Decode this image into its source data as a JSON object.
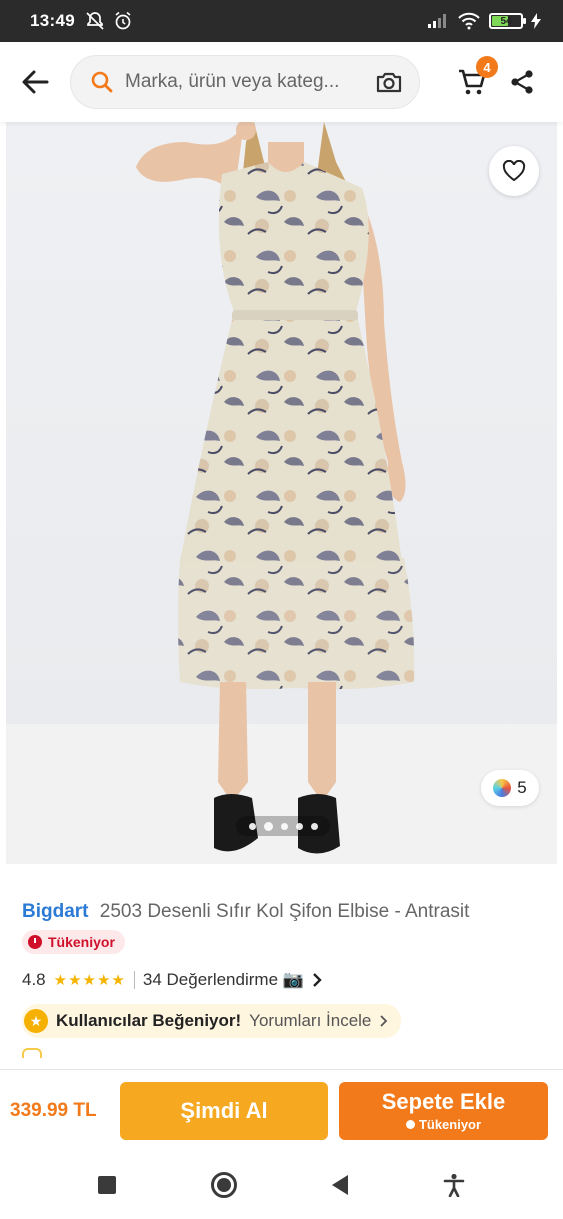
{
  "status_bar": {
    "time": "13:49",
    "battery_level": "54"
  },
  "header": {
    "search_placeholder": "Marka, ürün veya kateg...",
    "cart_count": "4"
  },
  "product_image": {
    "color_count": "5",
    "carousel_pages": 5,
    "active_page": 2
  },
  "product": {
    "brand": "Bigdart",
    "name": "2503 Desenli Sıfır Kol Şifon Elbise - Antrasit",
    "stock_status": "Tükeniyor",
    "rating": "4.8",
    "stars": "★★★★★",
    "review_count": "34 Değerlendirme 📷",
    "liked_label": "Kullanıcılar Beğeniyor!",
    "reviews_link": "Yorumları İncele"
  },
  "bottom_bar": {
    "price": "339.99 TL",
    "buy_now": "Şimdi Al",
    "add_to_cart": "Sepete Ekle",
    "add_to_cart_sub": "Tükeniyor"
  },
  "colors": {
    "accent": "#f27a1a",
    "buy_now": "#f6a821",
    "brand": "#2b7bd6",
    "stock_red": "#d0102a"
  }
}
